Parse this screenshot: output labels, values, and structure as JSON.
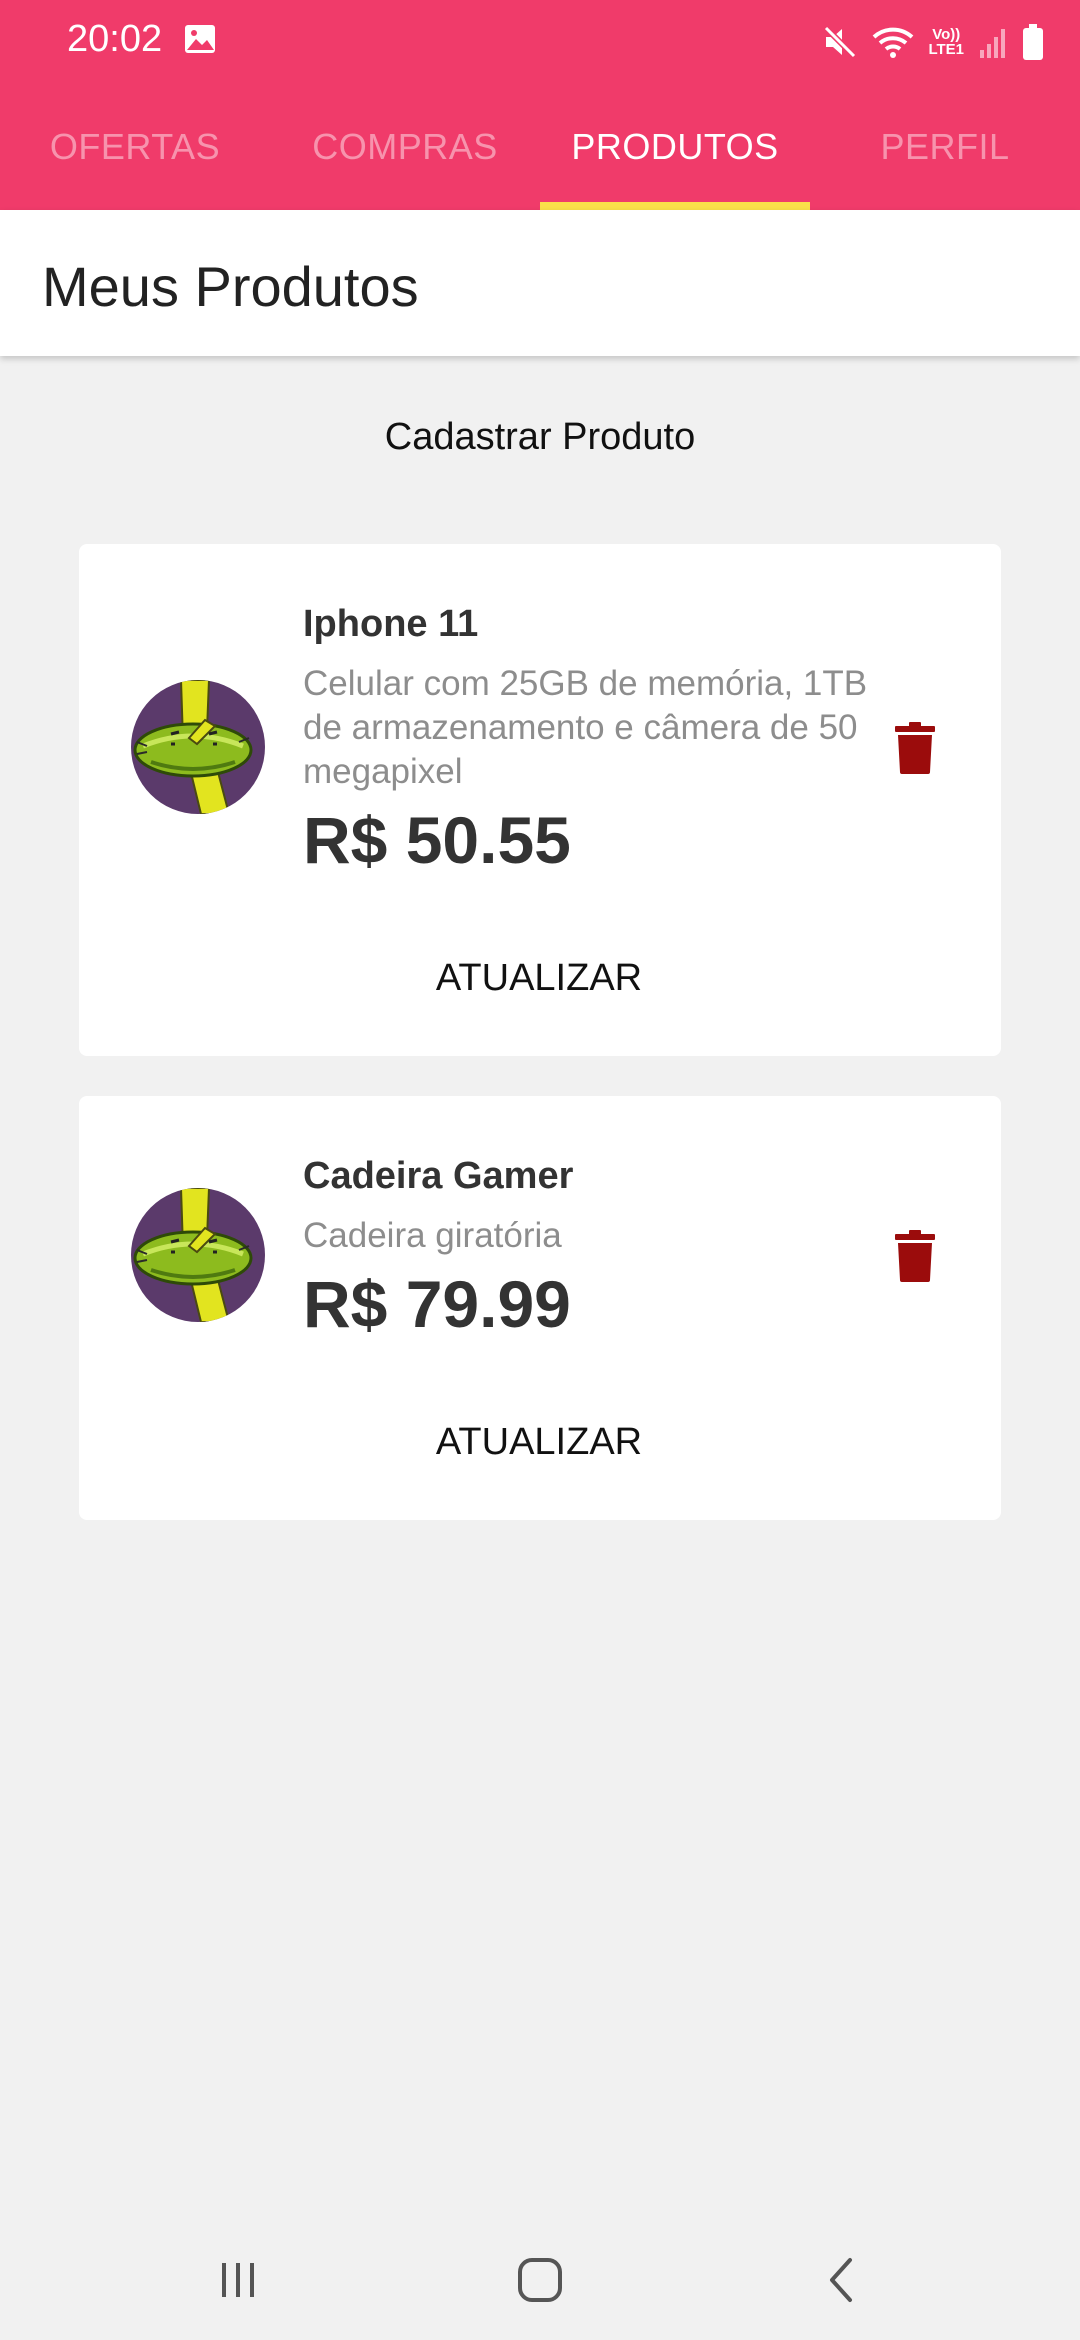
{
  "status_bar": {
    "time": "20:02",
    "volte_top": "Vo))",
    "volte_bottom": "LTE1",
    "icons": [
      "image-icon",
      "mute-icon",
      "wifi-icon",
      "volte-icon",
      "signal-icon",
      "battery-icon"
    ]
  },
  "tabs": [
    {
      "label": "OFERTAS",
      "active": false
    },
    {
      "label": "COMPRAS",
      "active": false
    },
    {
      "label": "PRODUTOS",
      "active": true
    },
    {
      "label": "PERFIL",
      "active": false
    }
  ],
  "header": {
    "title": "Meus Produtos"
  },
  "register_button": "Cadastrar Produto",
  "products": [
    {
      "name": "Iphone 11",
      "description": "Celular com 25GB de memória, 1TB de armazenamento e câmera de 50 megapixel",
      "price": "R$ 50.55",
      "update_label": "ATUALIZAR"
    },
    {
      "name": "Cadeira Gamer",
      "description": "Cadeira giratória",
      "price": "R$ 79.99",
      "update_label": "ATUALIZAR"
    }
  ],
  "colors": {
    "primary": "#f03b6a",
    "tab_indicator": "#fadf4a",
    "delete": "#9b0c0c",
    "background": "#f1f1f1"
  },
  "nav_bar": {
    "icons": [
      "recents-icon",
      "home-icon",
      "back-icon"
    ]
  }
}
